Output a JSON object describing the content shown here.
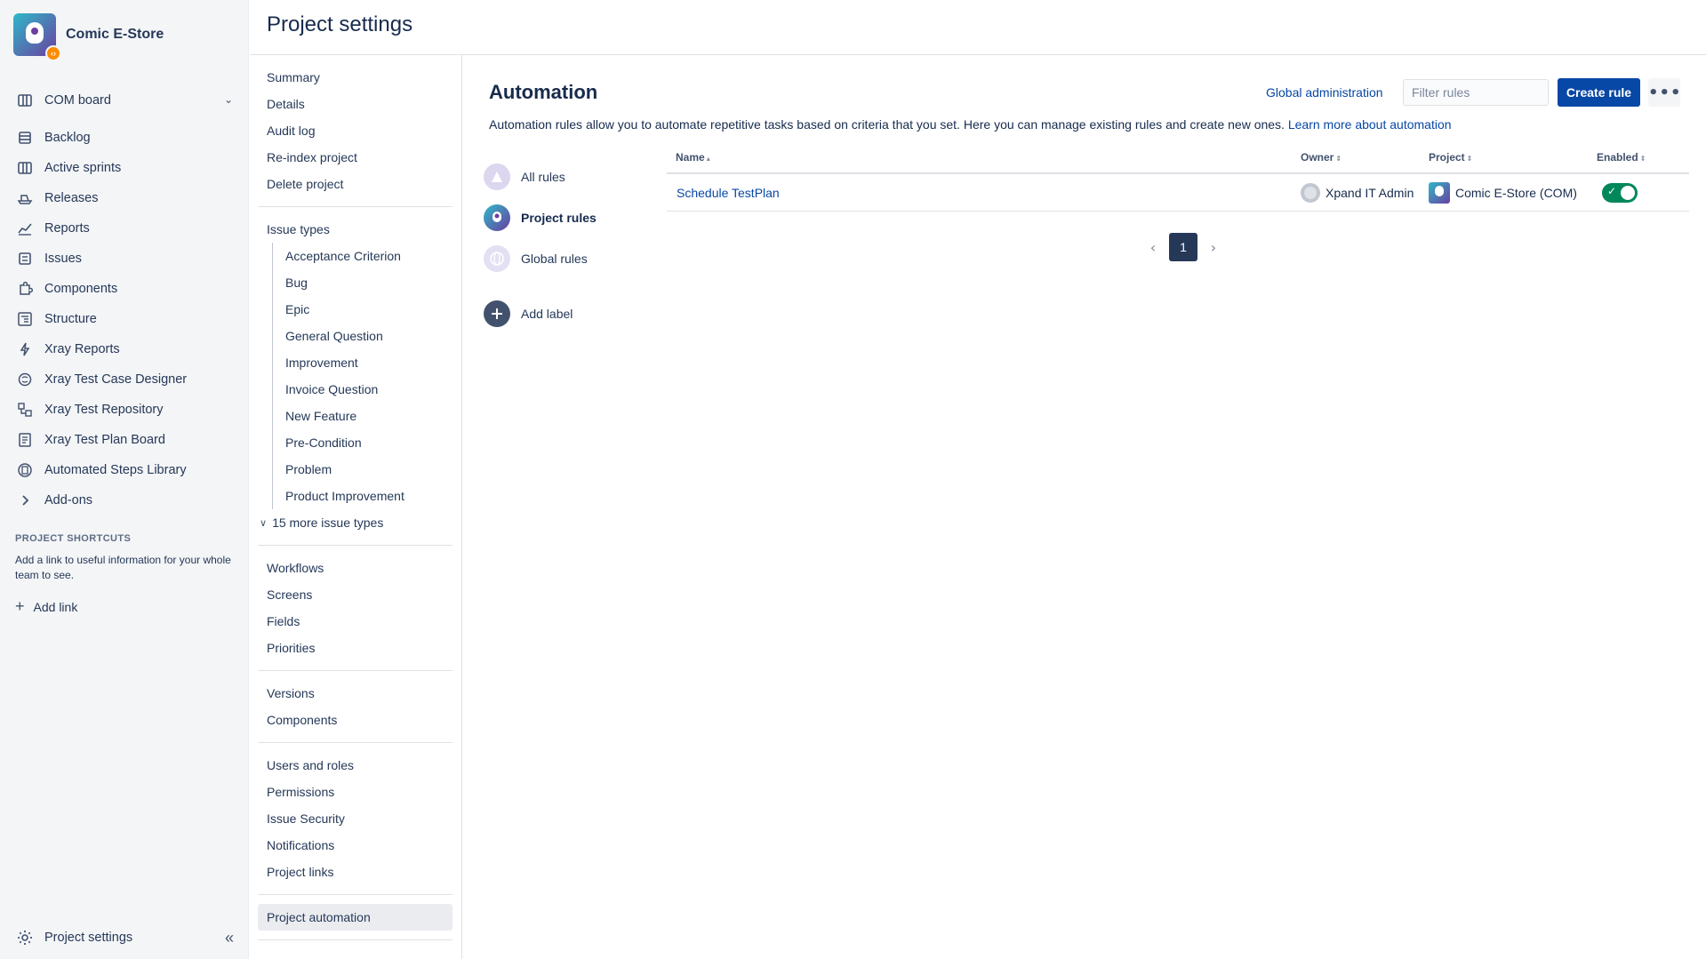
{
  "project": {
    "name": "Comic E-Store"
  },
  "sidebar": {
    "board": "COM board",
    "items": [
      {
        "label": "Backlog"
      },
      {
        "label": "Active sprints"
      },
      {
        "label": "Releases"
      },
      {
        "label": "Reports"
      },
      {
        "label": "Issues"
      },
      {
        "label": "Components"
      },
      {
        "label": "Structure"
      },
      {
        "label": "Xray Reports"
      },
      {
        "label": "Xray Test Case Designer"
      },
      {
        "label": "Xray Test Repository"
      },
      {
        "label": "Xray Test Plan Board"
      },
      {
        "label": "Automated Steps Library"
      },
      {
        "label": "Add-ons"
      }
    ],
    "shortcuts_heading": "PROJECT SHORTCUTS",
    "shortcuts_text": "Add a link to useful information for your whole team to see.",
    "add_link": "Add link",
    "footer": "Project settings"
  },
  "header": {
    "title": "Project settings"
  },
  "settings_nav": {
    "group1": [
      "Summary",
      "Details",
      "Audit log",
      "Re-index project",
      "Delete project"
    ],
    "issue_types_label": "Issue types",
    "issue_types": [
      "Acceptance Criterion",
      "Bug",
      "Epic",
      "General Question",
      "Improvement",
      "Invoice Question",
      "New Feature",
      "Pre-Condition",
      "Problem",
      "Product Improvement"
    ],
    "more_types": "15 more issue types",
    "group3": [
      "Workflows",
      "Screens",
      "Fields",
      "Priorities"
    ],
    "group4": [
      "Versions",
      "Components"
    ],
    "group5": [
      "Users and roles",
      "Permissions",
      "Issue Security",
      "Notifications",
      "Project links"
    ],
    "group6": [
      "Project automation"
    ]
  },
  "automation": {
    "title": "Automation",
    "global_admin": "Global administration",
    "filter_placeholder": "Filter rules",
    "create_rule": "Create rule",
    "more": "•••",
    "description": "Automation rules allow you to automate repetitive tasks based on criteria that you set. Here you can manage existing rules and create new ones.",
    "learn_more": "Learn more about automation",
    "labels": {
      "all": "All rules",
      "project": "Project rules",
      "global": "Global rules",
      "add": "Add label"
    },
    "table": {
      "headers": {
        "name": "Name",
        "owner": "Owner",
        "project": "Project",
        "enabled": "Enabled"
      },
      "rows": [
        {
          "name": "Schedule TestPlan",
          "owner": "Xpand IT Admin",
          "project": "Comic E-Store (COM)",
          "enabled": true
        }
      ]
    },
    "pagination": {
      "current": "1"
    }
  }
}
